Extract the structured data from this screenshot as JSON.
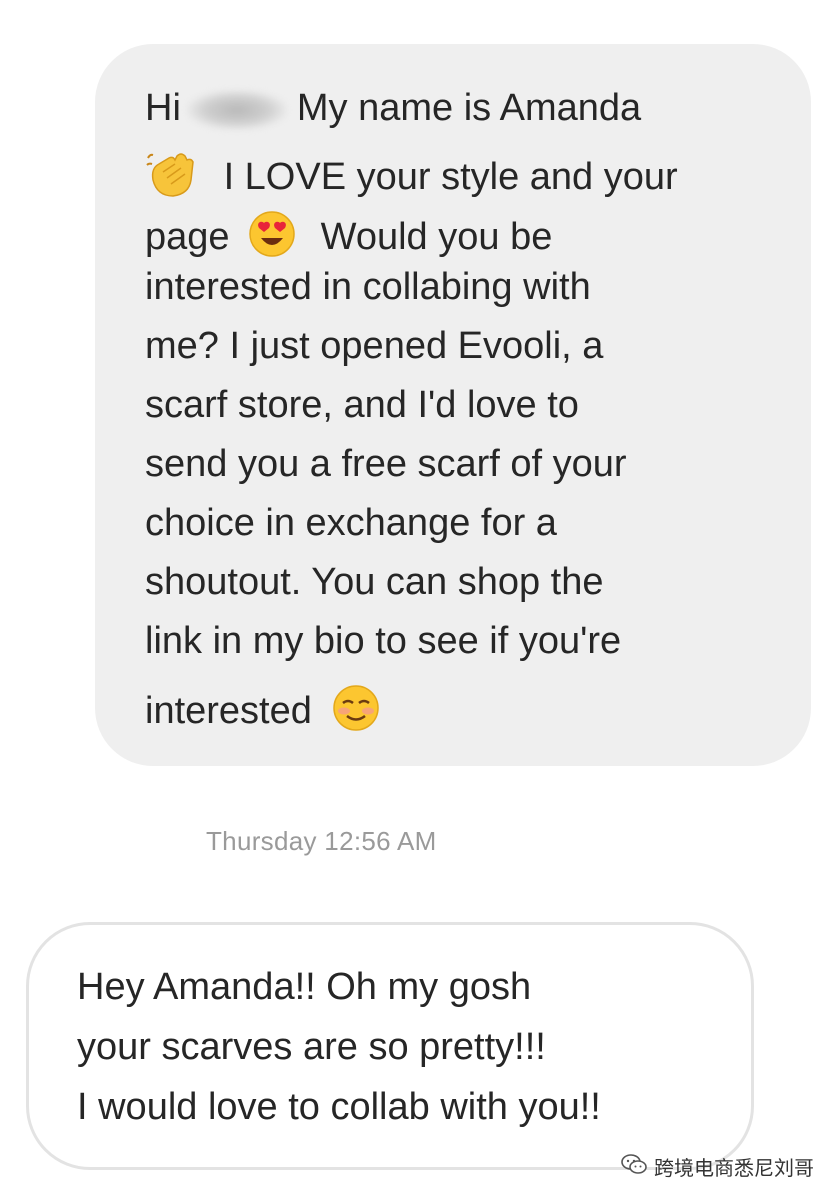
{
  "conversation": {
    "incoming_message": {
      "lines": [
        {
          "before_redaction": "Hi",
          "after_redaction": "My name is Amanda"
        },
        {
          "text": "I LOVE your style and your",
          "emoji": "waving-hand-emoji"
        },
        {
          "text_before": "page",
          "emoji": "heart-eyes-emoji",
          "text_after": "Would you be"
        },
        {
          "text": "interested in collabing with"
        },
        {
          "text": "me? I just opened Evooli, a"
        },
        {
          "text": "scarf store, and I'd love to"
        },
        {
          "text": "send you a free scarf of your"
        },
        {
          "text": "choice in exchange for a"
        },
        {
          "text": "shoutout. You can shop the"
        },
        {
          "text": "link in my bio to see if you're"
        },
        {
          "text": "interested",
          "emoji": "smiling-blush-emoji"
        }
      ]
    },
    "timestamp": "Thursday 12:56 AM",
    "outgoing_message": {
      "lines": [
        "Hey Amanda!! Oh my gosh",
        "your scarves are so pretty!!!",
        "I would love to collab with you!!"
      ]
    }
  },
  "watermark": {
    "text": "跨境电商悉尼刘哥",
    "icon": "wechat-icon"
  }
}
